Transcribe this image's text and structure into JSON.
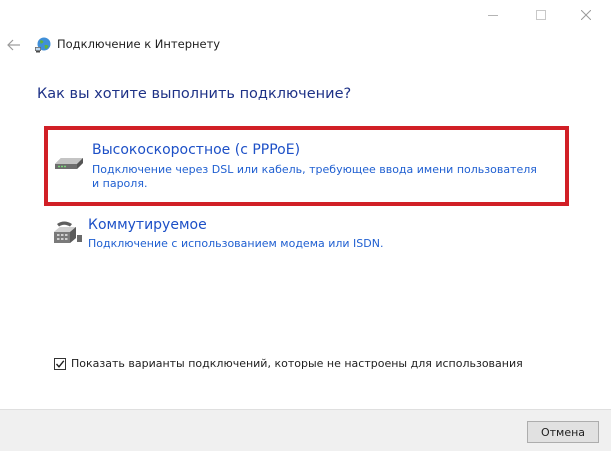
{
  "window": {
    "title": "Подключение к Интернету",
    "controls": [
      "minimize-icon",
      "maximize-icon",
      "close-icon"
    ]
  },
  "header": {
    "back_icon": "back-arrow-icon",
    "app_icon": "globe-network-icon"
  },
  "question": "Как вы хотите выполнить подключение?",
  "options": [
    {
      "icon": "broadband-modem-icon",
      "title": "Высокоскоростное (с PPPoE)",
      "description": "Подключение через DSL или кабель, требующее ввода имени пользователя и пароля.",
      "highlighted": true,
      "highlight_color": "#d11f26"
    },
    {
      "icon": "dial-up-telephone-icon",
      "title": "Коммутируемое",
      "description": "Подключение с использованием модема или ISDN."
    }
  ],
  "show_unconfigured": {
    "label": "Показать варианты подключений, которые не настроены для использования",
    "checked": true
  },
  "footer": {
    "cancel_label": "Отмена"
  },
  "colors": {
    "link": "#1d50c7",
    "heading": "#1e3287",
    "highlight": "#d11f26"
  }
}
